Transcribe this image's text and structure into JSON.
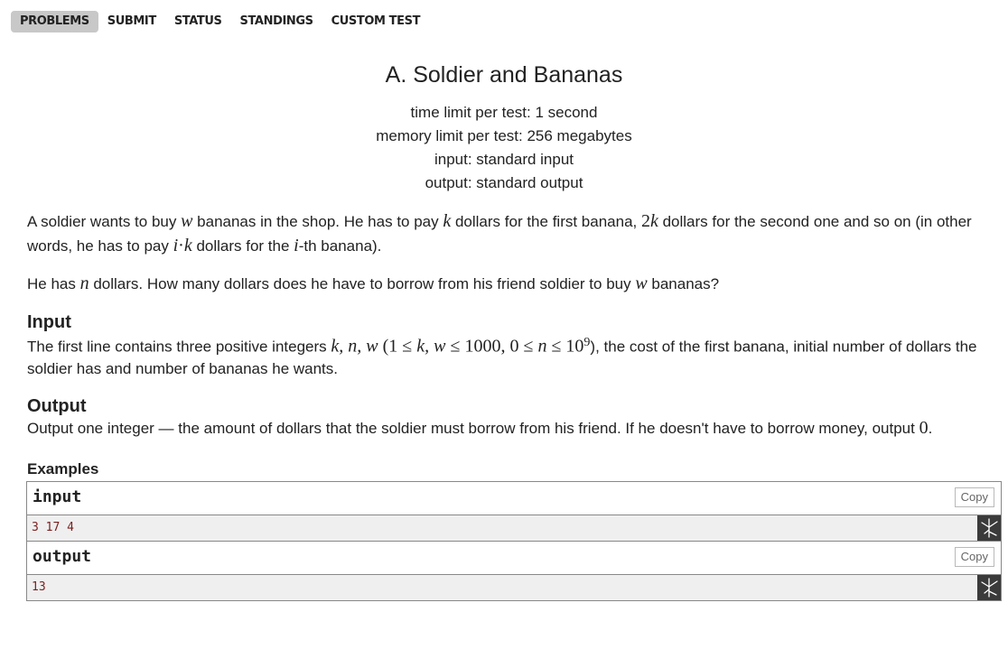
{
  "menu": [
    "PROBLEMS",
    "SUBMIT",
    "STATUS",
    "STANDINGS",
    "CUSTOM TEST"
  ],
  "problem": {
    "title": "A. Soldier and Bananas",
    "time_limit": "time limit per test: 1 second",
    "memory_limit": "memory limit per test: 256 megabytes",
    "input_file": "input: standard input",
    "output_file": "output: standard output"
  },
  "legend": {
    "p1_a": "A soldier wants to buy ",
    "p1_b": " bananas in the shop. He has to pay ",
    "p1_c": " dollars for the first banana, ",
    "p1_d": " dollars for the second one and so on (in other words, he has to pay ",
    "p1_e": " dollars for the ",
    "p1_f": "-th banana).",
    "p2_a": "He has ",
    "p2_b": " dollars. How many dollars does he have to borrow from his friend soldier to buy ",
    "p2_c": " bananas?",
    "var_w": "w",
    "var_k": "k",
    "var_n": "n",
    "var_i": "i",
    "expr_2": "2",
    "expr_dot": "·"
  },
  "input_section": {
    "title": "Input",
    "text_a": "The first line contains three positive integers ",
    "vars": "k, n, w",
    "open_paren": " (",
    "constraint_a": "1 ≤ ",
    "constraint_b": "k, w",
    "constraint_c": " ≤ 1000, 0 ≤ ",
    "constraint_d": "n",
    "constraint_e": " ≤ 10",
    "constraint_exp": "9",
    "text_b": "), the cost of the first banana, initial number of dollars the soldier has and number of bananas he wants."
  },
  "output_section": {
    "title": "Output",
    "text_a": "Output one integer — the amount of dollars that the soldier must borrow from his friend. If he doesn't have to borrow money, output ",
    "zero": "0",
    "text_b": "."
  },
  "examples": {
    "title": "Examples",
    "copy_label": "Copy",
    "input_label": "input",
    "input_value": "3 17 4",
    "output_label": "output",
    "output_value": "13"
  },
  "icons": {
    "graph": "graph-icon"
  }
}
